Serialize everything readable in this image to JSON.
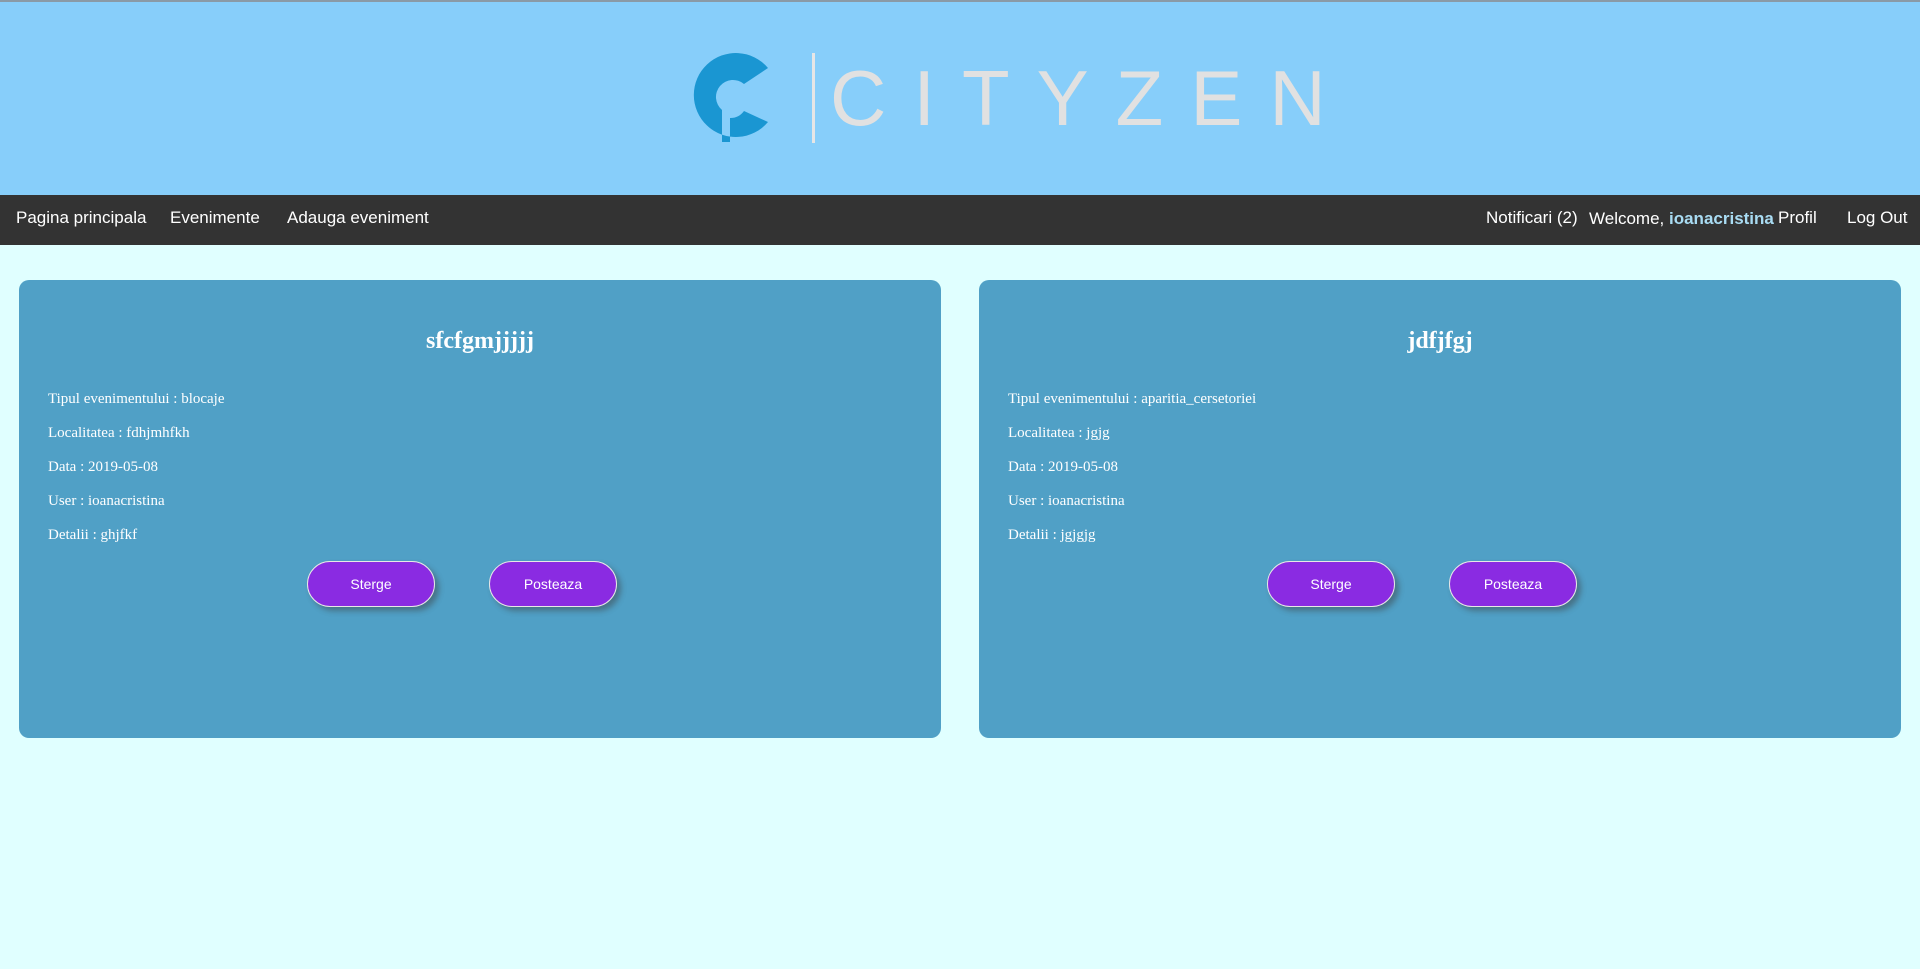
{
  "header": {
    "logo_text": "CITYZEN",
    "brand_color": "#1a96d2",
    "background": "#87cefa"
  },
  "nav": {
    "left_items": [
      "Pagina principala",
      "Evenimente",
      "Adauga eveniment"
    ],
    "notifications": "Notificari (2)",
    "welcome_prefix": "Welcome, ",
    "username": "ioanacristina",
    "profile": "Profil",
    "logout": "Log Out"
  },
  "events": [
    {
      "title": "sfcfgmjjjjj",
      "type_line": "Tipul evenimentului : blocaje",
      "location_line": "Localitatea : fdhjmhfkh",
      "date_line": "Data : 2019-05-08",
      "user_line": "User : ioanacristina",
      "details_line": "Detalii : ghjfkf",
      "delete_label": "Sterge",
      "post_label": "Posteaza"
    },
    {
      "title": "jdfjfgj",
      "type_line": "Tipul evenimentului : aparitia_cersetoriei",
      "location_line": "Localitatea : jgjg",
      "date_line": "Data : 2019-05-08",
      "user_line": "User : ioanacristina",
      "details_line": "Detalii : jgjgjg",
      "delete_label": "Sterge",
      "post_label": "Posteaza"
    }
  ]
}
